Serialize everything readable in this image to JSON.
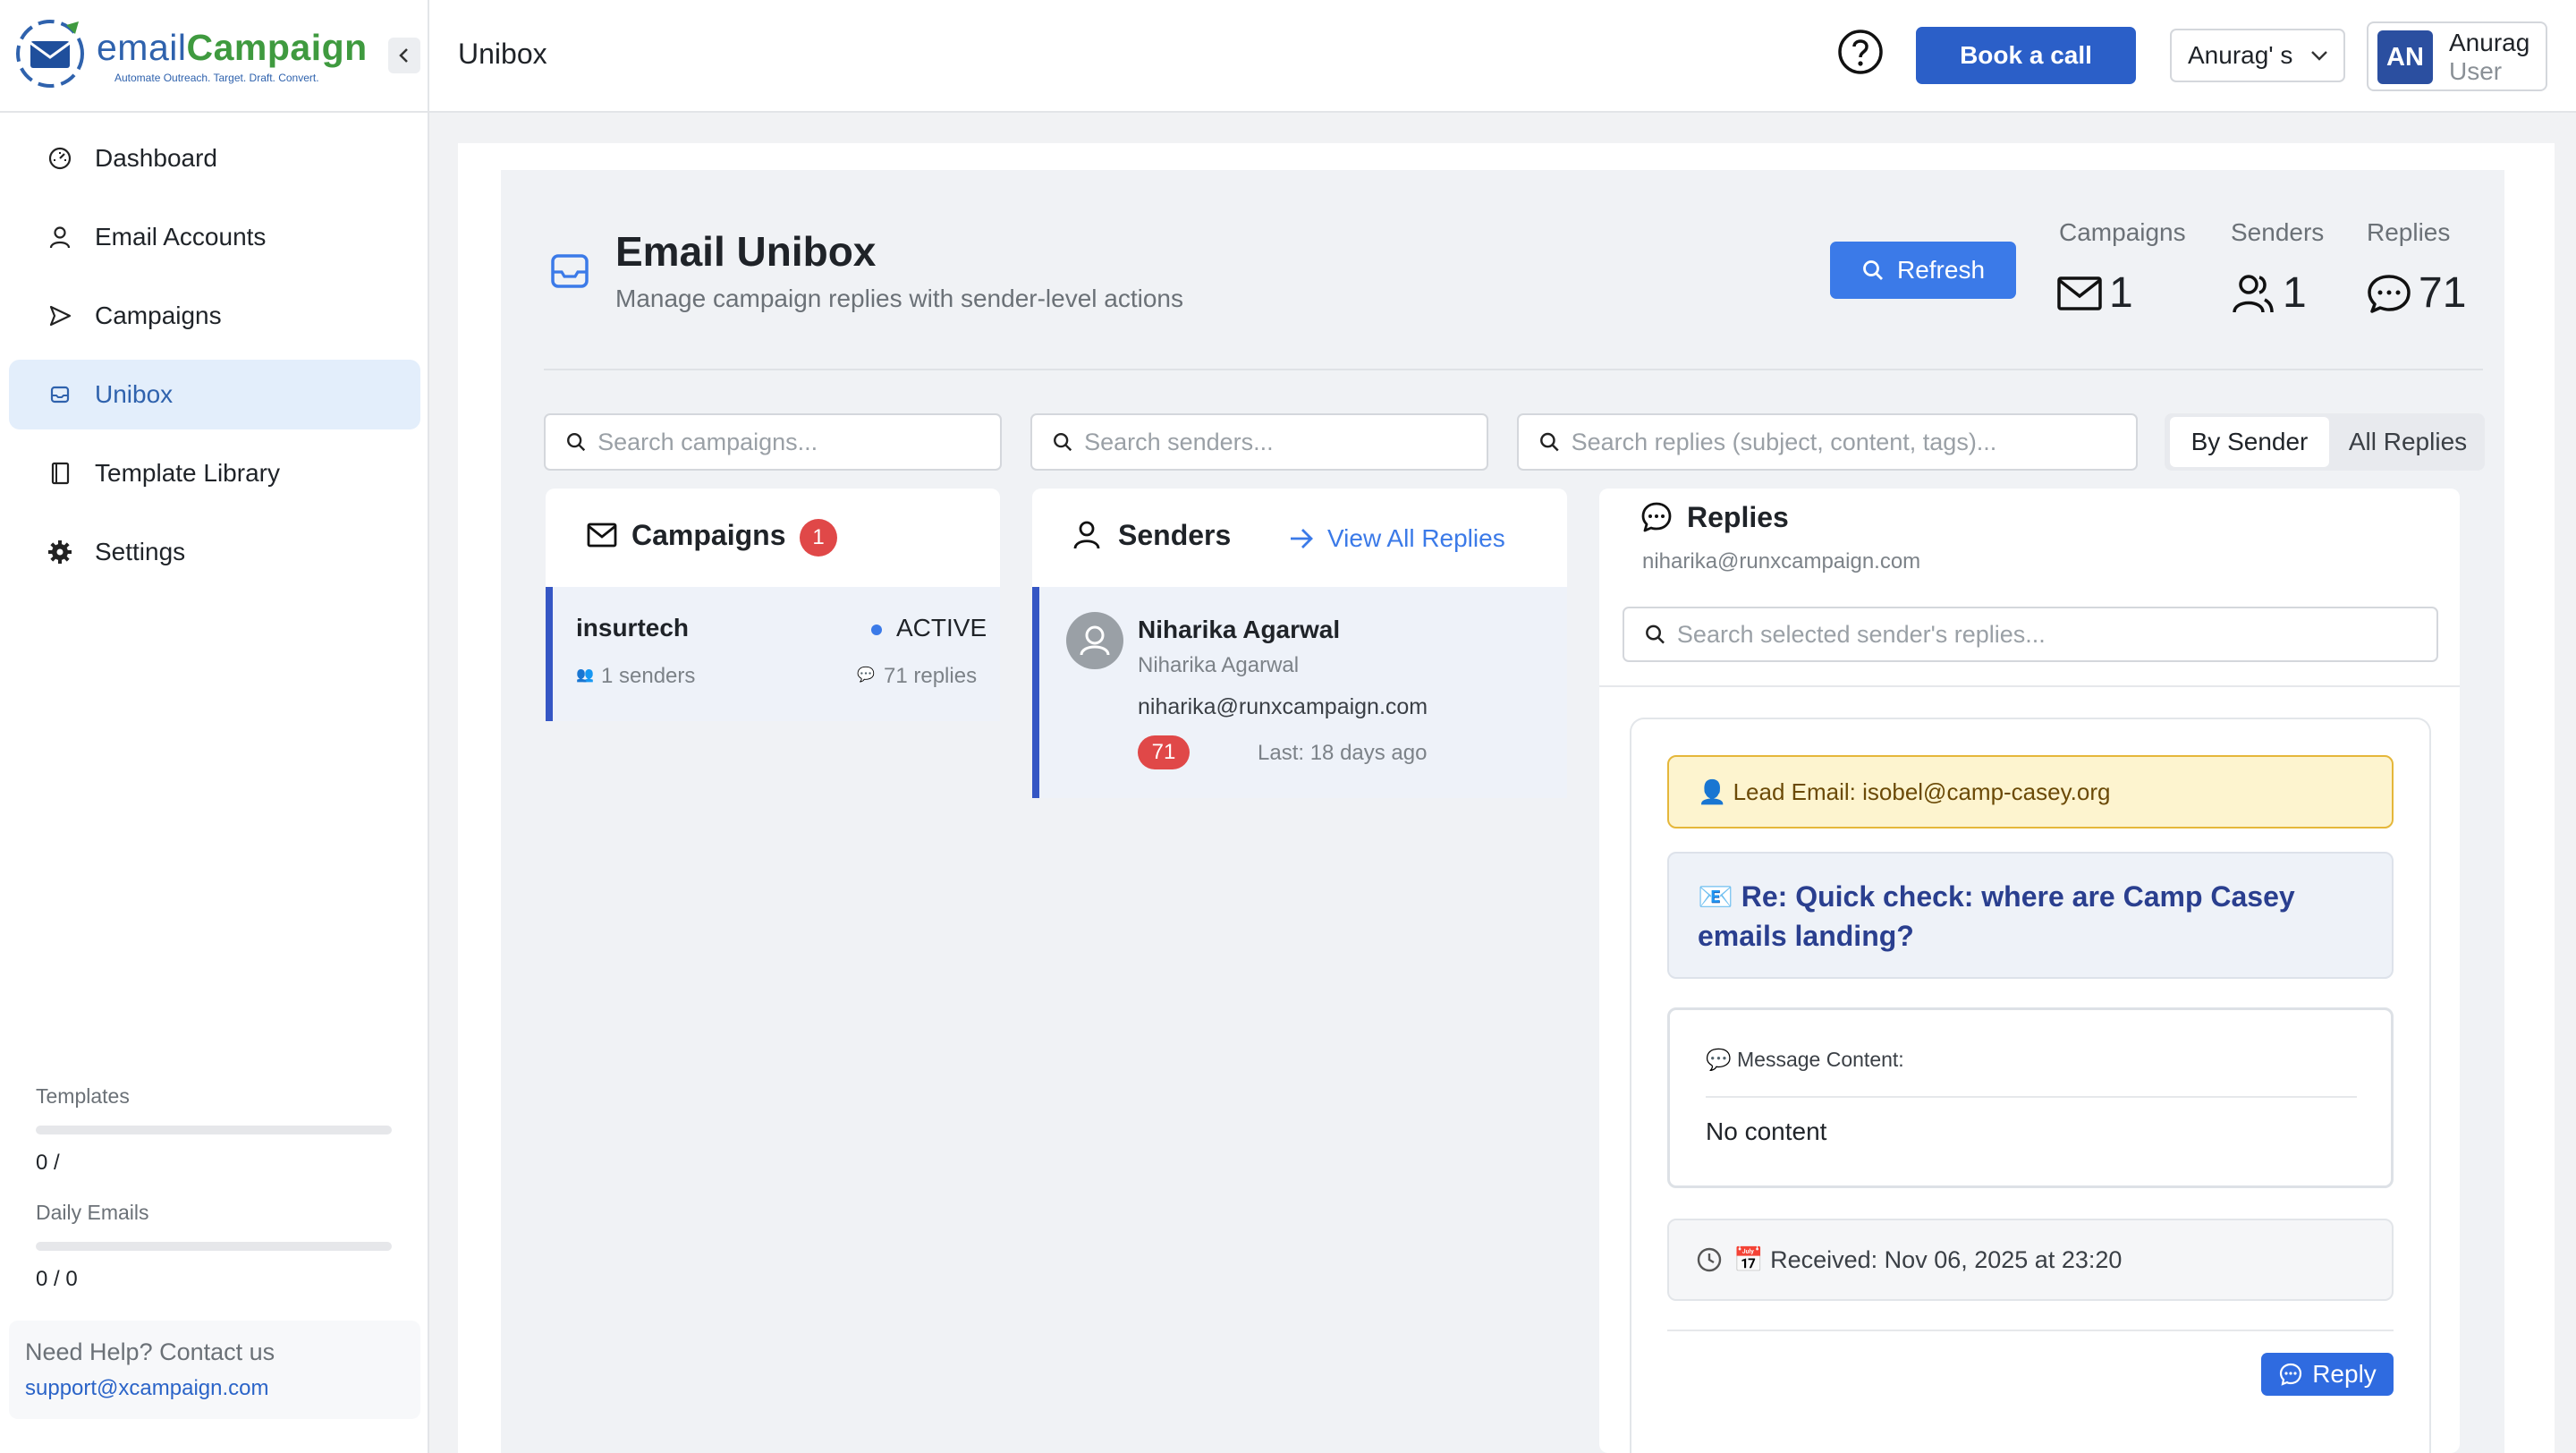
{
  "brand": {
    "name_light": "email",
    "name_bold": "Campaign",
    "tagline": "Automate Outreach. Target. Draft. Convert."
  },
  "sidebar": {
    "items": [
      {
        "label": "Dashboard",
        "icon": "gauge-icon"
      },
      {
        "label": "Email Accounts",
        "icon": "user-icon"
      },
      {
        "label": "Campaigns",
        "icon": "send-icon"
      },
      {
        "label": "Unibox",
        "icon": "inbox-icon",
        "active": true
      },
      {
        "label": "Template Library",
        "icon": "book-icon"
      },
      {
        "label": "Settings",
        "icon": "gear-icon"
      }
    ],
    "usage": {
      "templates_label": "Templates",
      "templates_value": "0 /",
      "daily_label": "Daily Emails",
      "daily_value": "0 / 0"
    },
    "help": {
      "title": "Need Help? Contact us",
      "email": "support@xcampaign.com"
    }
  },
  "topbar": {
    "page_title": "Unibox",
    "book_call": "Book a call",
    "org_select": "Anurag' s",
    "user_initials": "AN",
    "user_name": "Anurag",
    "user_role": "User"
  },
  "unibox": {
    "title": "Email Unibox",
    "subtitle": "Manage campaign replies with sender-level actions",
    "refresh": "Refresh",
    "stats": {
      "campaigns_label": "Campaigns",
      "campaigns_value": "1",
      "senders_label": "Senders",
      "senders_value": "1",
      "replies_label": "Replies",
      "replies_value": "71"
    },
    "search": {
      "campaigns_placeholder": "Search campaigns...",
      "senders_placeholder": "Search senders...",
      "replies_placeholder": "Search replies (subject, content, tags)...",
      "selected_placeholder": "Search selected sender's replies..."
    },
    "view_toggle": {
      "by_sender": "By Sender",
      "all_replies": "All Replies"
    },
    "campaigns_panel": {
      "title": "Campaigns",
      "count": "1",
      "items": [
        {
          "name": "insurtech",
          "status": "ACTIVE",
          "senders": "1 senders",
          "replies": "71 replies"
        }
      ]
    },
    "senders_panel": {
      "title": "Senders",
      "view_all": "View All Replies",
      "items": [
        {
          "name": "Niharika Agarwal",
          "subname": "Niharika Agarwal",
          "email": "niharika@runxcampaign.com",
          "count": "71",
          "last": "Last: 18 days ago"
        }
      ]
    },
    "replies_panel": {
      "title": "Replies",
      "sender_email": "niharika@runxcampaign.com",
      "lead_email": "👤 Lead Email: isobel@camp-casey.org",
      "subject": "📧 Re: Quick check: where are Camp Casey emails landing?",
      "message_label": "💬 Message Content:",
      "message_body": "No content",
      "received": "📅 Received: Nov 06, 2025 at 23:20",
      "reply_button": "Reply"
    }
  },
  "colors": {
    "primary": "#2b5fc8",
    "refresh": "#3b7ae8",
    "active_nav_bg": "#e3eefb",
    "badge_red": "#e04848",
    "lead_bg": "#fdf4cf"
  }
}
